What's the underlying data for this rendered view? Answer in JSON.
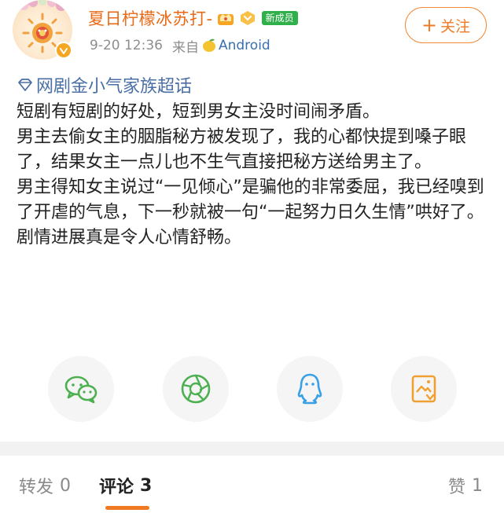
{
  "header": {
    "username": "夏日柠檬冰苏打-",
    "new_member_badge": "新成员",
    "time": "9-20 12:36",
    "from_label": "来自",
    "device": "Android",
    "follow_label": "关注"
  },
  "post": {
    "topic": "网剧金小气家族超话",
    "paragraphs": [
      "短剧有短剧的好处，短到男女主没时间闹矛盾。",
      "男主去偷女主的胭脂秘方被发现了，我的心都快提到嗓子眼了，结果女主一点儿也不生气直接把秘方送给男主了。",
      "男主得知女主说过“一见倾心”是骗他的非常委屈，我已经嗅到了开虐的气息，下一秒就被一句“一起努力日久生情”哄好了。",
      "剧情进展真是令人心情舒畅。"
    ]
  },
  "share": {
    "icons": [
      "wechat-icon",
      "moments-icon",
      "qq-icon",
      "save-image-icon"
    ]
  },
  "tabs": {
    "repost": {
      "label": "转发",
      "count": "0"
    },
    "comment": {
      "label": "评论",
      "count": "3"
    },
    "like": {
      "label": "赞",
      "count": "1"
    }
  },
  "colors": {
    "username": "#e86a17",
    "accent_orange": "#f07a23",
    "topic_blue": "#4a6fa5",
    "wechat_green": "#4caf50",
    "qq_blue": "#3aa0e6",
    "save_orange": "#f0a030",
    "new_member_green": "#2fb04a"
  }
}
